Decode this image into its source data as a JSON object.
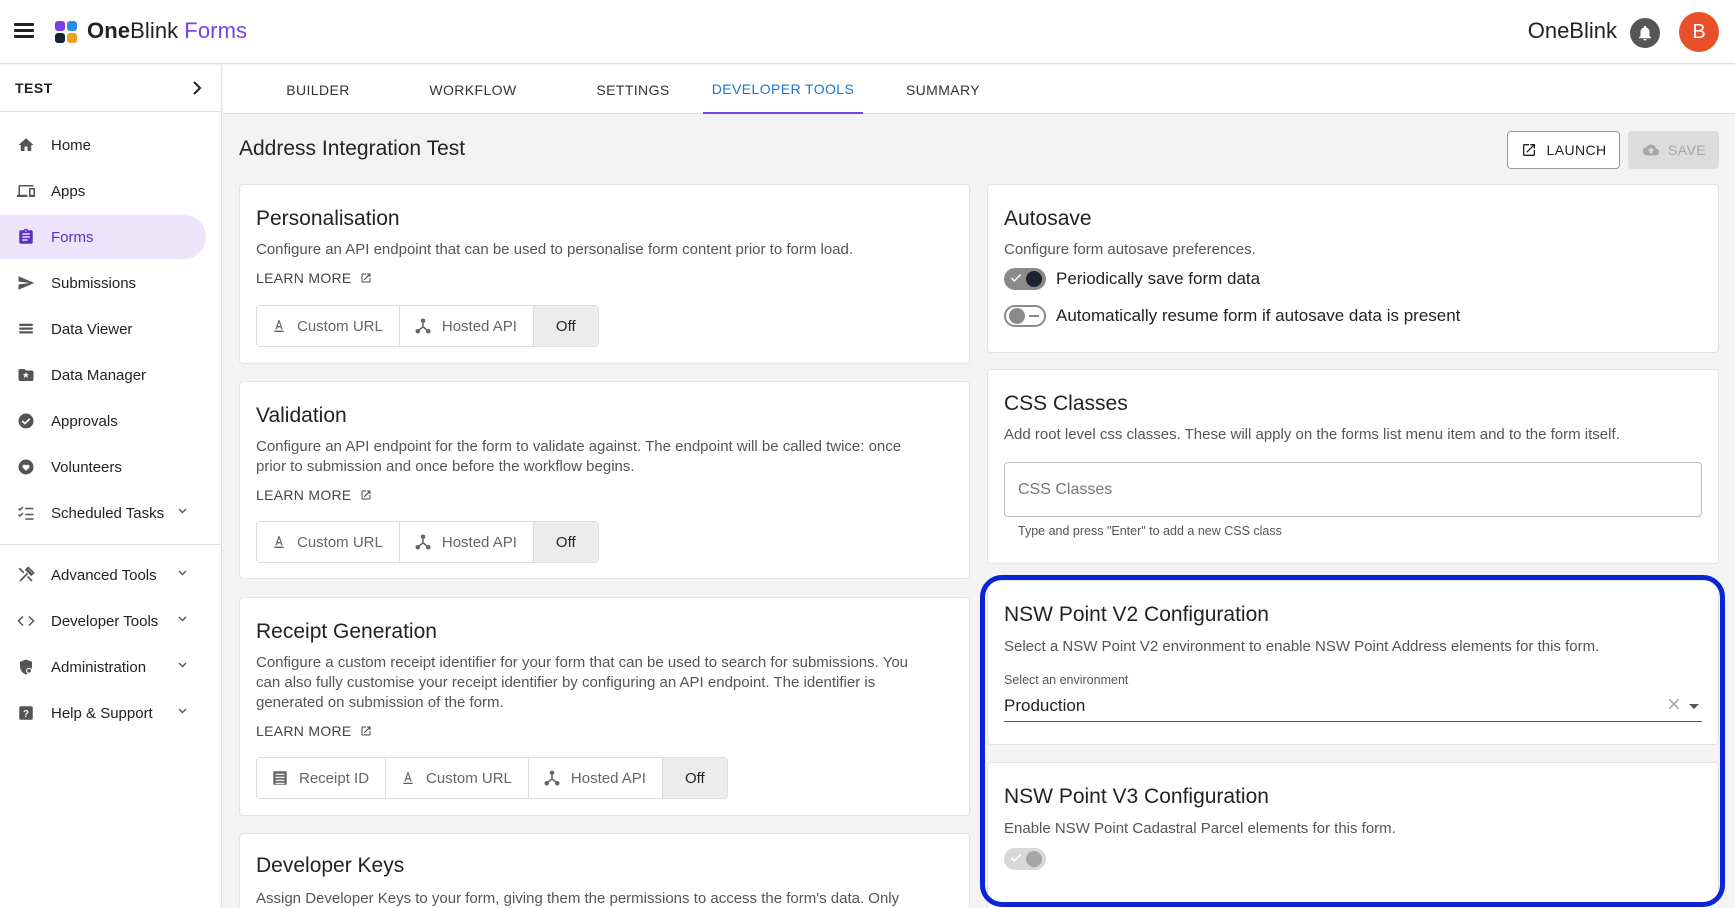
{
  "app": {
    "brand_one": "One",
    "brand_blink": "Blink",
    "brand_forms": "Forms",
    "org_name": "OneBlink",
    "avatar_initial": "B"
  },
  "sidebar": {
    "project": "TEST",
    "items": [
      {
        "label": "Home",
        "icon": "home-icon"
      },
      {
        "label": "Apps",
        "icon": "devices-icon"
      },
      {
        "label": "Forms",
        "icon": "clipboard-icon",
        "active": true
      },
      {
        "label": "Submissions",
        "icon": "send-icon"
      },
      {
        "label": "Data Viewer",
        "icon": "list-icon"
      },
      {
        "label": "Data Manager",
        "icon": "folder-icon"
      },
      {
        "label": "Approvals",
        "icon": "check-circle-icon"
      },
      {
        "label": "Volunteers",
        "icon": "heart-icon"
      },
      {
        "label": "Scheduled Tasks",
        "icon": "checklist-icon",
        "expandable": true
      }
    ],
    "items2": [
      {
        "label": "Advanced Tools",
        "icon": "tools-icon",
        "expandable": true
      },
      {
        "label": "Developer Tools",
        "icon": "code-icon",
        "expandable": true
      },
      {
        "label": "Administration",
        "icon": "shield-icon",
        "expandable": true
      },
      {
        "label": "Help & Support",
        "icon": "help-icon",
        "expandable": true
      }
    ]
  },
  "tabs": {
    "builder": "BUILDER",
    "workflow": "WORKFLOW",
    "settings": "SETTINGS",
    "developer_tools": "DEVELOPER TOOLS",
    "summary": "SUMMARY",
    "active": "DEVELOPER TOOLS"
  },
  "page": {
    "title": "Address Integration Test",
    "launch_label": "LAUNCH",
    "save_label": "SAVE"
  },
  "personalisation": {
    "title": "Personalisation",
    "desc": "Configure an API endpoint that can be used to personalise form content prior to form load.",
    "learn_more": "LEARN MORE",
    "options": [
      "Custom URL",
      "Hosted API",
      "Off"
    ],
    "selected": "Off"
  },
  "validation": {
    "title": "Validation",
    "desc_line1": "Configure an API endpoint for the form to validate against. The endpoint will be called twice: once",
    "desc_line2": "prior to submission and once before the workflow begins.",
    "learn_more": "LEARN MORE",
    "options": [
      "Custom URL",
      "Hosted API",
      "Off"
    ],
    "selected": "Off"
  },
  "receipt": {
    "title": "Receipt Generation",
    "desc_line1": "Configure a custom receipt identifier for your form that can be used to search for submissions. You",
    "desc_line2": "can also fully customise your receipt identifier by configuring an API endpoint. The identifier is",
    "desc_line3": "generated on submission of the form.",
    "learn_more": "LEARN MORE",
    "options": [
      "Receipt ID",
      "Custom URL",
      "Hosted API",
      "Off"
    ],
    "selected": "Off"
  },
  "developer_keys": {
    "title": "Developer Keys",
    "desc": "Assign Developer Keys to your form, giving them the permissions to access the form's data. Only"
  },
  "autosave": {
    "title": "Autosave",
    "desc": "Configure form autosave preferences.",
    "periodic_label": "Periodically save form data",
    "periodic_on": true,
    "resume_label": "Automatically resume form if autosave data is present",
    "resume_on": false
  },
  "css_classes": {
    "title": "CSS Classes",
    "desc": "Add root level css classes. These will apply on the forms list menu item and to the form itself.",
    "placeholder": "CSS Classes",
    "helper": "Type and press \"Enter\" to add a new CSS class"
  },
  "nsw_v2": {
    "title": "NSW Point V2 Configuration",
    "desc": "Select a NSW Point V2 environment to enable NSW Point Address elements for this form.",
    "select_label": "Select an environment",
    "value": "Production"
  },
  "nsw_v3": {
    "title": "NSW Point V3 Configuration",
    "desc": "Enable NSW Point Cadastral Parcel elements for this form.",
    "enabled": true,
    "disabled": true
  },
  "colors": {
    "accent": "#7b3fe4",
    "active_tab_text": "#1976d2",
    "highlight": "#0b24d6",
    "avatar": "#e8502a"
  }
}
